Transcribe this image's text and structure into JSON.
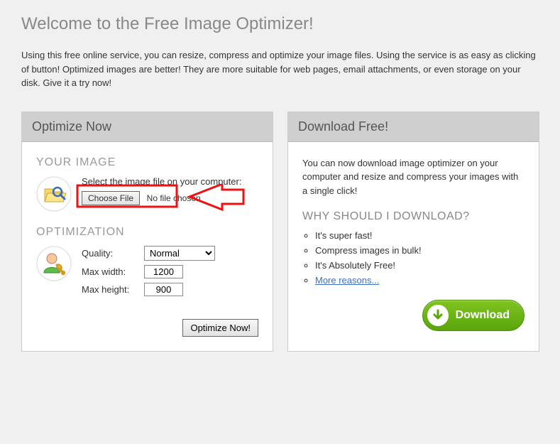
{
  "page": {
    "title": "Welcome to the Free Image Optimizer!",
    "intro": "Using this free online service, you can resize, compress and optimize your image files. Using the service is as easy as clicking of button! Optimized images are better! They are more suitable for web pages, email attachments, or even storage on your disk. Give it a try now!"
  },
  "optimize": {
    "header": "Optimize Now",
    "your_image_title": "YOUR IMAGE",
    "select_prompt": "Select the image file on your computer:",
    "choose_file_label": "Choose File",
    "file_status": "No file chosen",
    "optimization_title": "OPTIMIZATION",
    "quality_label": "Quality:",
    "quality_value": "Normal",
    "max_width_label": "Max width:",
    "max_width_value": "1200",
    "max_height_label": "Max height:",
    "max_height_value": "900",
    "optimize_button": "Optimize Now!"
  },
  "download": {
    "header": "Download Free!",
    "desc": "You can now download image optimizer on your computer and resize and compress your images with a single click!",
    "why_title": "WHY SHOULD I DOWNLOAD?",
    "bullets": {
      "0": "It's super fast!",
      "1": "Compress images in bulk!",
      "2": "It's Absolutely Free!"
    },
    "more_link": "More reasons...",
    "button_label": "Download"
  }
}
